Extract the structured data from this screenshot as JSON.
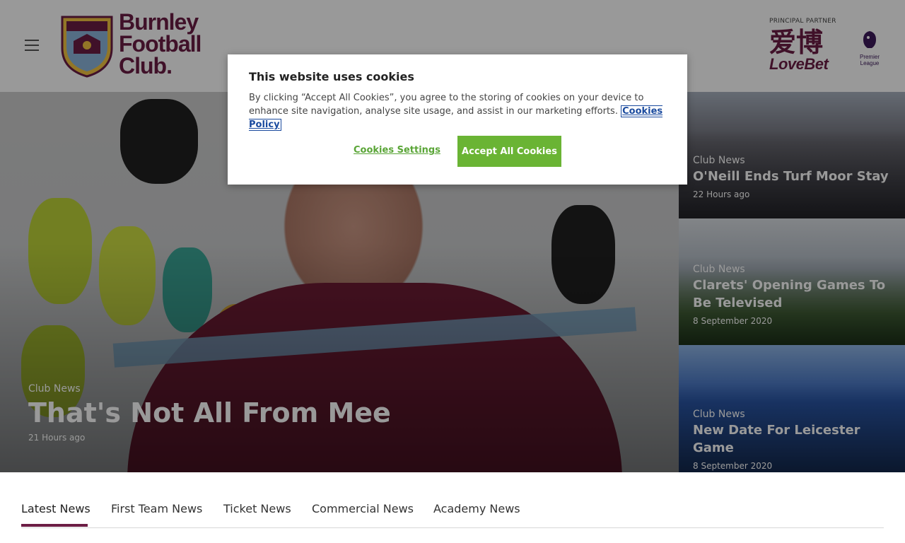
{
  "header": {
    "brand_lines": [
      "Burnley",
      "Football",
      "Club."
    ],
    "partner_label": "PRINCIPAL PARTNER",
    "partner_name_cn": "爱博",
    "partner_name": "LoveBet",
    "league_label_1": "Premier",
    "league_label_2": "League"
  },
  "hero": {
    "category": "Club News",
    "title": "That's Not All From Mee",
    "time": "21 Hours ago"
  },
  "cards": [
    {
      "category": "Club News",
      "title": "O'Neill Ends Turf Moor Stay",
      "time": "22 Hours ago"
    },
    {
      "category": "Club News",
      "title": "Clarets' Opening Games To Be Televised",
      "time": "8 September 2020"
    },
    {
      "category": "Club News",
      "title": "New Date For Leicester Game",
      "time": "8 September 2020"
    }
  ],
  "cookie": {
    "heading": "This website uses cookies",
    "body": "By clicking “Accept All Cookies”, you agree to the storing of cookies on your device to enhance site navigation, analyse site usage, and assist in our marketing efforts.",
    "policy_link": "Cookies Policy",
    "settings_label": "Cookies Settings",
    "accept_label": "Accept All Cookies"
  },
  "tabs": [
    {
      "label": "Latest News"
    },
    {
      "label": "First Team News"
    },
    {
      "label": "Ticket News"
    },
    {
      "label": "Commercial News"
    },
    {
      "label": "Academy News"
    }
  ],
  "colors": {
    "brand": "#6c1d45",
    "accept_button": "#6ab434",
    "link": "#1a4a9e"
  }
}
